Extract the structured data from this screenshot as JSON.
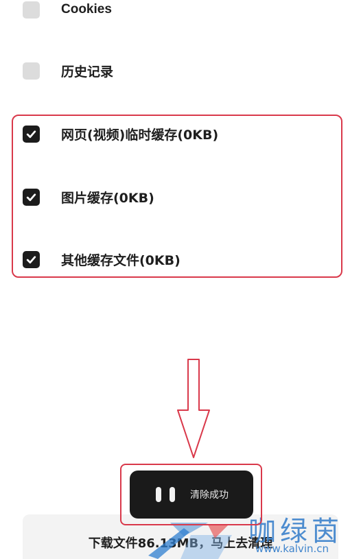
{
  "options": [
    {
      "label": "Cookies",
      "checked": false
    },
    {
      "label": "历史记录",
      "checked": false
    },
    {
      "label": "网页(视频)临时缓存(0KB)",
      "checked": true
    },
    {
      "label": "图片缓存(0KB)",
      "checked": true
    },
    {
      "label": "其他缓存文件(0KB)",
      "checked": true
    }
  ],
  "toast": {
    "message": "清除成功"
  },
  "bottom": {
    "text": "下载文件86.13MB，马上去清理"
  },
  "watermark": {
    "cn": "咖绿茵",
    "url": "www.kalvin.cn"
  },
  "colors": {
    "annotation": "#d9384a",
    "checkbox_on": "#1c1c1c",
    "checkbox_off": "#dcdcdc",
    "toast_bg": "#1a1a1a",
    "watermark": "#3f84cc"
  }
}
